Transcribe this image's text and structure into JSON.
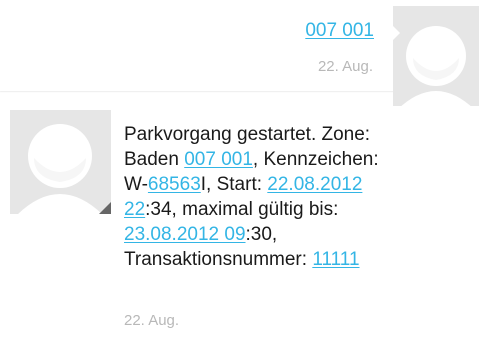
{
  "outgoing": {
    "text": "007 001",
    "date": "22. Aug."
  },
  "incoming": {
    "segments": [
      {
        "text": "Parkvorgang gestartet. Zone:",
        "link": false,
        "br": true
      },
      {
        "text": "Baden ",
        "link": false
      },
      {
        "text": "007 001",
        "link": true
      },
      {
        "text": ", Kennzeichen:",
        "link": false,
        "br": true
      },
      {
        "text": "W-",
        "link": false
      },
      {
        "text": "68563",
        "link": true
      },
      {
        "text": "I, Start: ",
        "link": false
      },
      {
        "text": "22.08.2012",
        "link": true,
        "br": true
      },
      {
        "text": "22",
        "link": true
      },
      {
        "text": ":34, maximal gültig bis:",
        "link": false,
        "br": true
      },
      {
        "text": "23.08.2012 09",
        "link": true
      },
      {
        "text": ":30,",
        "link": false,
        "br": true
      },
      {
        "text": "Transaktionsnummer: ",
        "link": false
      },
      {
        "text": "11111",
        "link": true
      }
    ],
    "date": "22. Aug."
  },
  "colors": {
    "link": "#33b5e5",
    "date": "#b8b8b8",
    "avatar_bg": "#e6e6e6",
    "avatar_fg": "#ffffff"
  },
  "icons": {
    "contact_avatar": "default-contact-avatar-icon"
  }
}
